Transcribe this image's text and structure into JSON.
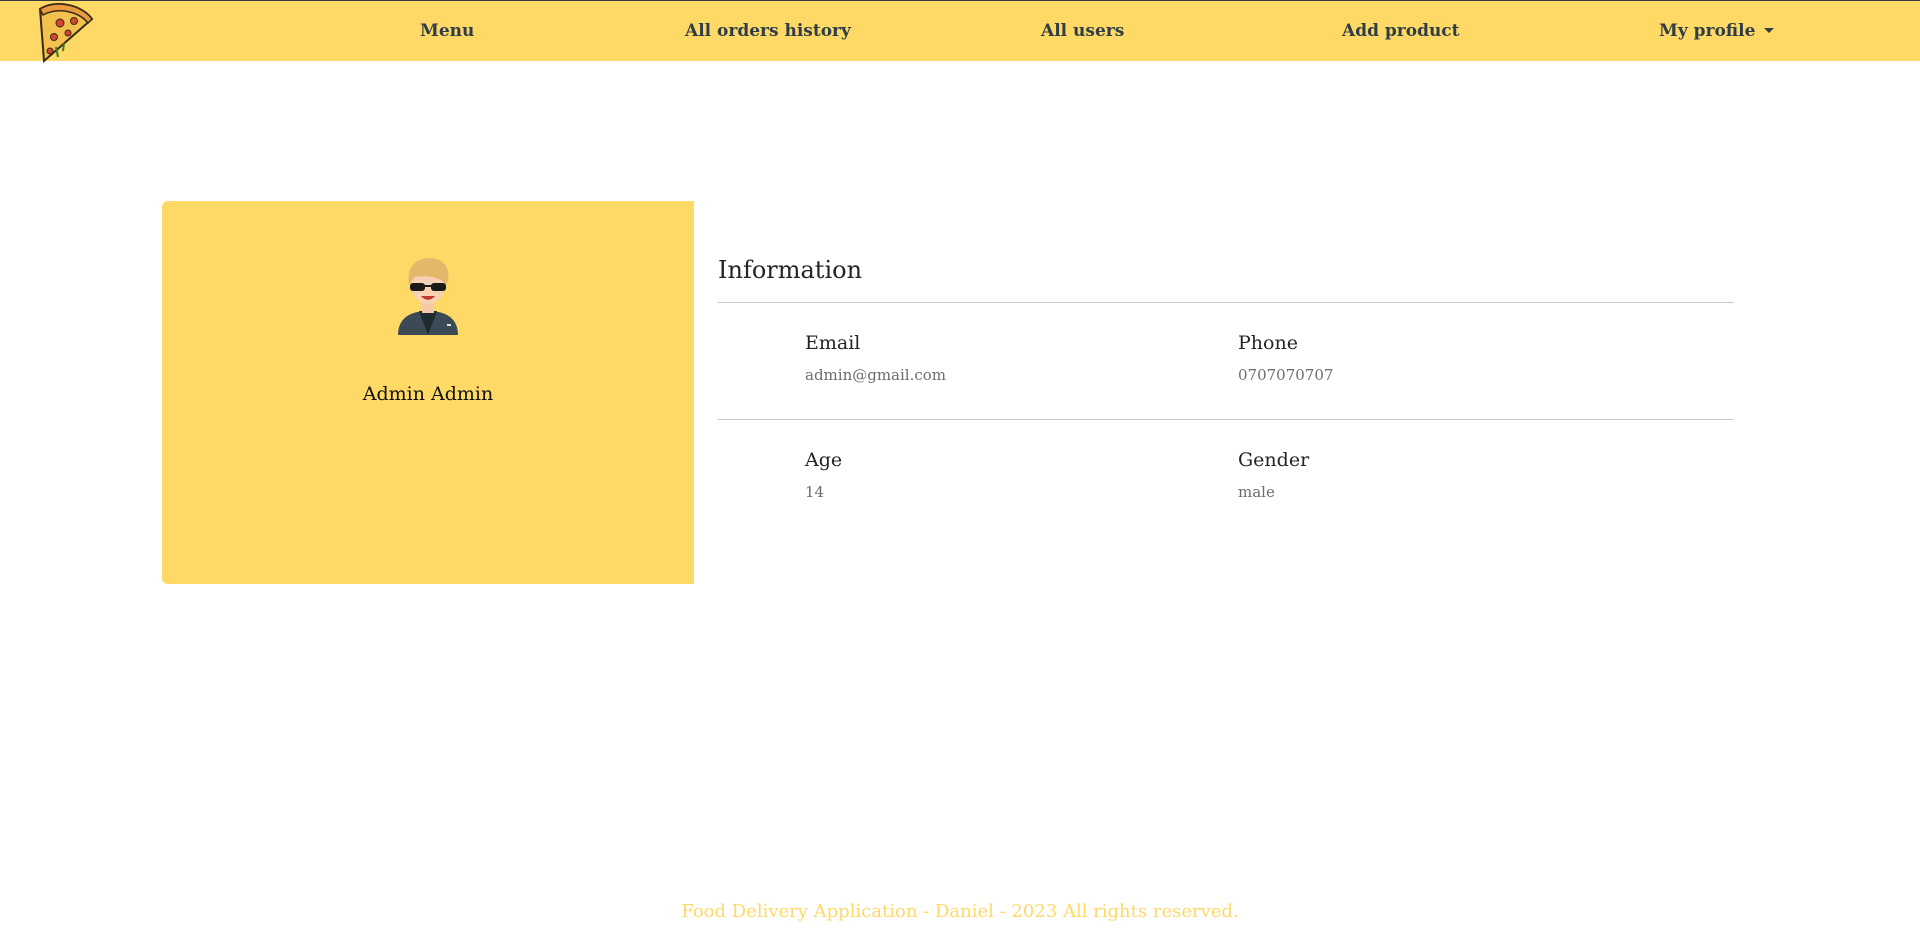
{
  "nav": {
    "logo_icon": "pizza-slice-icon",
    "items": [
      {
        "label": "Menu"
      },
      {
        "label": "All orders history"
      },
      {
        "label": "All users"
      },
      {
        "label": "Add product"
      }
    ],
    "profile_label": "My profile"
  },
  "profile": {
    "name": "Admin Admin",
    "avatar_icon": "user-avatar-sunglasses-icon"
  },
  "info": {
    "title": "Information",
    "email_label": "Email",
    "email_value": "admin@gmail.com",
    "phone_label": "Phone",
    "phone_value": "0707070707",
    "age_label": "Age",
    "age_value": "14",
    "gender_label": "Gender",
    "gender_value": "male"
  },
  "footer": {
    "text": "Food Delivery Application - Daniel - 2023 All rights reserved."
  },
  "colors": {
    "accent": "#ffd966",
    "nav_text": "#2f3e46"
  }
}
